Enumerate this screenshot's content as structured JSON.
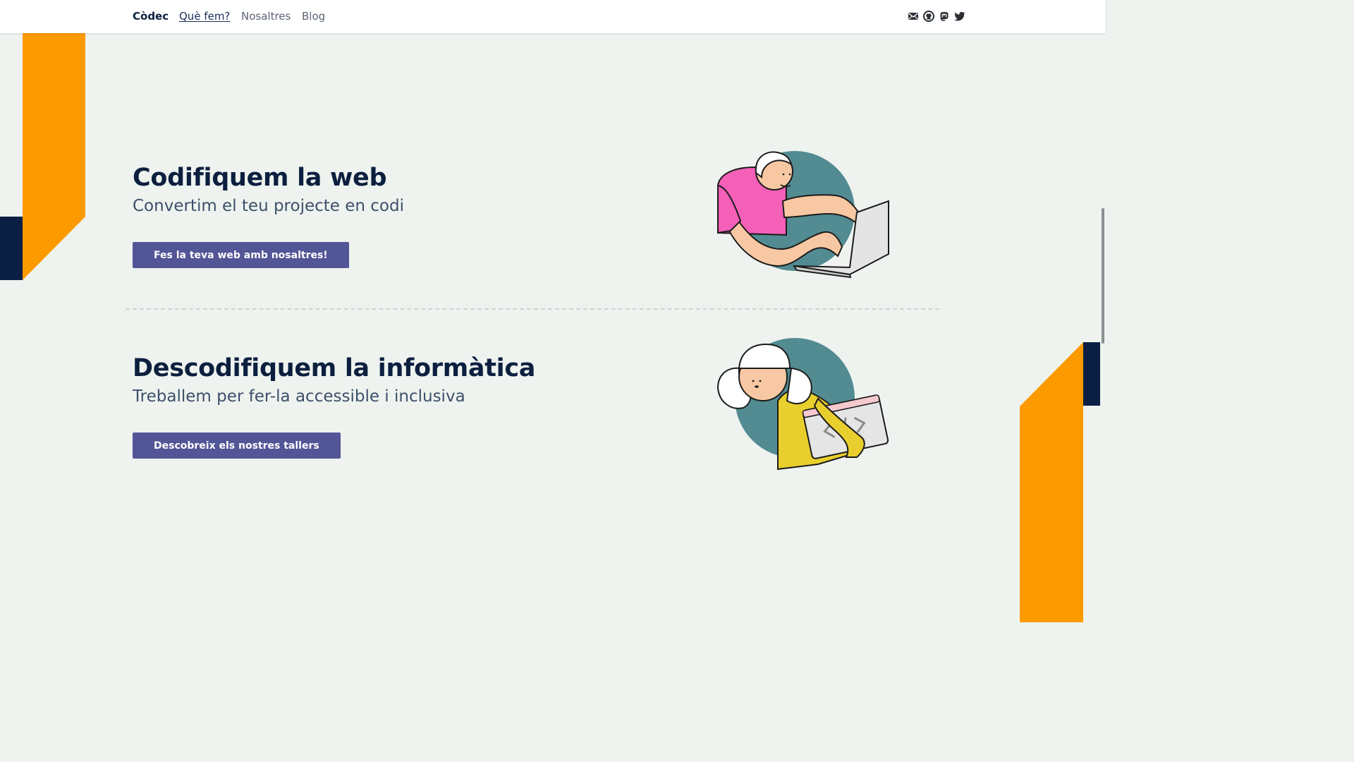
{
  "nav": {
    "brand": "Còdec",
    "links": [
      "Què fem?",
      "Nosaltres",
      "Blog"
    ],
    "active_link": "Què fem?",
    "social_icons": [
      "mail-icon",
      "github-icon",
      "mastodon-icon",
      "twitter-icon"
    ]
  },
  "hero1": {
    "title": "Codifiquem la web",
    "subtitle": "Convertim el teu projecte en codi",
    "button": "Fes la teva web amb nosaltres!"
  },
  "hero2": {
    "title": "Descodifiquem la informàtica",
    "subtitle": "Treballem per fer-la accessible i inclusiva",
    "button": "Descobreix els nostres tallers"
  },
  "colors": {
    "background": "#eef3ef",
    "accent_orange": "#fd9a00",
    "navy": "#0b1f45",
    "button": "#525596",
    "teal": "#538b92",
    "pink": "#f45fb8",
    "yellow": "#e9cf2e"
  }
}
